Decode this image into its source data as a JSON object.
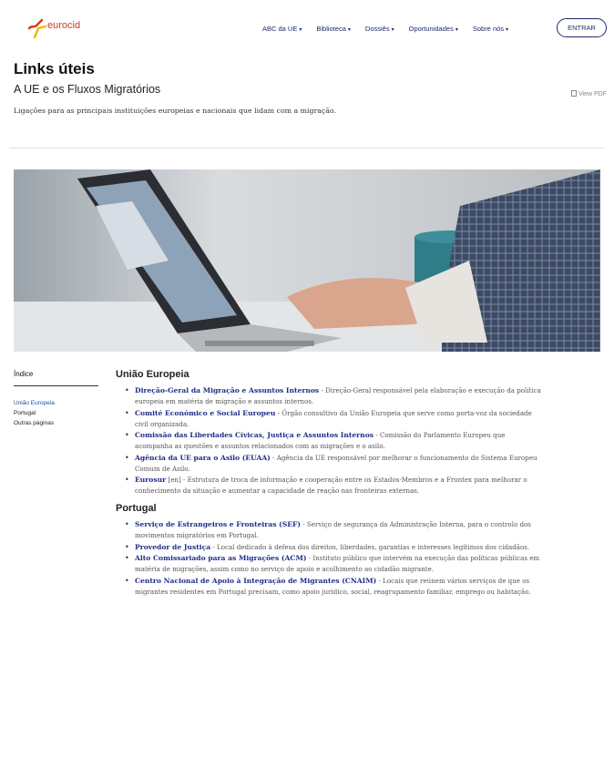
{
  "header": {
    "logo_text": "eurocid",
    "nav": [
      {
        "label": "ABC da UE"
      },
      {
        "label": "Biblioteca"
      },
      {
        "label": "Dossiês"
      },
      {
        "label": "Oportunidades"
      },
      {
        "label": "Sobre nós"
      }
    ],
    "login_label": "ENTRAR"
  },
  "page": {
    "title": "Links úteis",
    "subtitle": "A UE e os Fluxos Migratórios",
    "description": "Ligações para as principais instituições europeias e nacionais que lidam com a migração.",
    "view_pdf": "View PDF"
  },
  "toc": {
    "title": "Índice",
    "items": [
      "União Europeia",
      "Portugal",
      "Outras páginas"
    ]
  },
  "sections": [
    {
      "title": "União Europeia",
      "items": [
        {
          "link": "Direção-Geral da Migração e Assuntos Internos",
          "lang": "",
          "desc": " - Direção-Geral responsável pela elaboração e execução da política europeia em matéria de migração e assuntos internos."
        },
        {
          "link": "Comité Económico e Social Europeu",
          "lang": "",
          "desc": " - Órgão consultivo da União Europeia que serve como porta-voz da sociedade civil organizada."
        },
        {
          "link": "Comissão das Liberdades Cívicas, Justiça e Assuntos Internos",
          "lang": "",
          "desc": " - Comissão do Parlamento Europeu que acompanha as questões e assuntos relacionados com as migrações e o asilo."
        },
        {
          "link": "Agência da UE para o Asilo (EUAA)",
          "lang": "",
          "desc": " - Agência da UE responsável por melhorar o funcionamento do Sistema Europeu Comum de Asilo."
        },
        {
          "link": "Eurosur",
          "lang": " [en]",
          "desc": " - Estrutura de troca de informação e cooperação entre os Estados-Membros e a Frontex para melhorar o conhecimento da situação e aumentar a capacidade de reação nas fronteiras externas."
        }
      ]
    },
    {
      "title": "Portugal",
      "items": [
        {
          "link": "Serviço de Estrangeiros e Fronteiras (SEF)",
          "lang": "",
          "desc": " -  Serviço de segurança da Administração Interna, para o controlo dos movimentos migratórios em Portugal."
        },
        {
          "link": "Provedor de Justiça",
          "lang": "",
          "desc": " - Local dedicado à defesa dos direitos, liberdades, garantias e interesses legítimos dos cidadãos."
        },
        {
          "link": "Alto Comissariado para as Migrações (ACM)",
          "lang": "",
          "desc": " - Instituto público que intervém na execução das políticas públicas em matéria de migrações, assim como no serviço de apoio e acolhimento ao cidadão migrante."
        },
        {
          "link": "Centro Nacional de Apoio à Integração de Migrantes (CNAIM)",
          "lang": "",
          "desc": " - Locais que reúnem vários serviços de que os migrantes residentes em Portugal precisam, como apoio jurídico, social, reagrupamento familiar, emprego ou habitação."
        }
      ]
    }
  ],
  "colors": {
    "brand_red": "#d33a1b",
    "brand_yellow": "#f2b705",
    "nav_blue": "#1f2a6b",
    "link_blue": "#1f2d8a"
  }
}
